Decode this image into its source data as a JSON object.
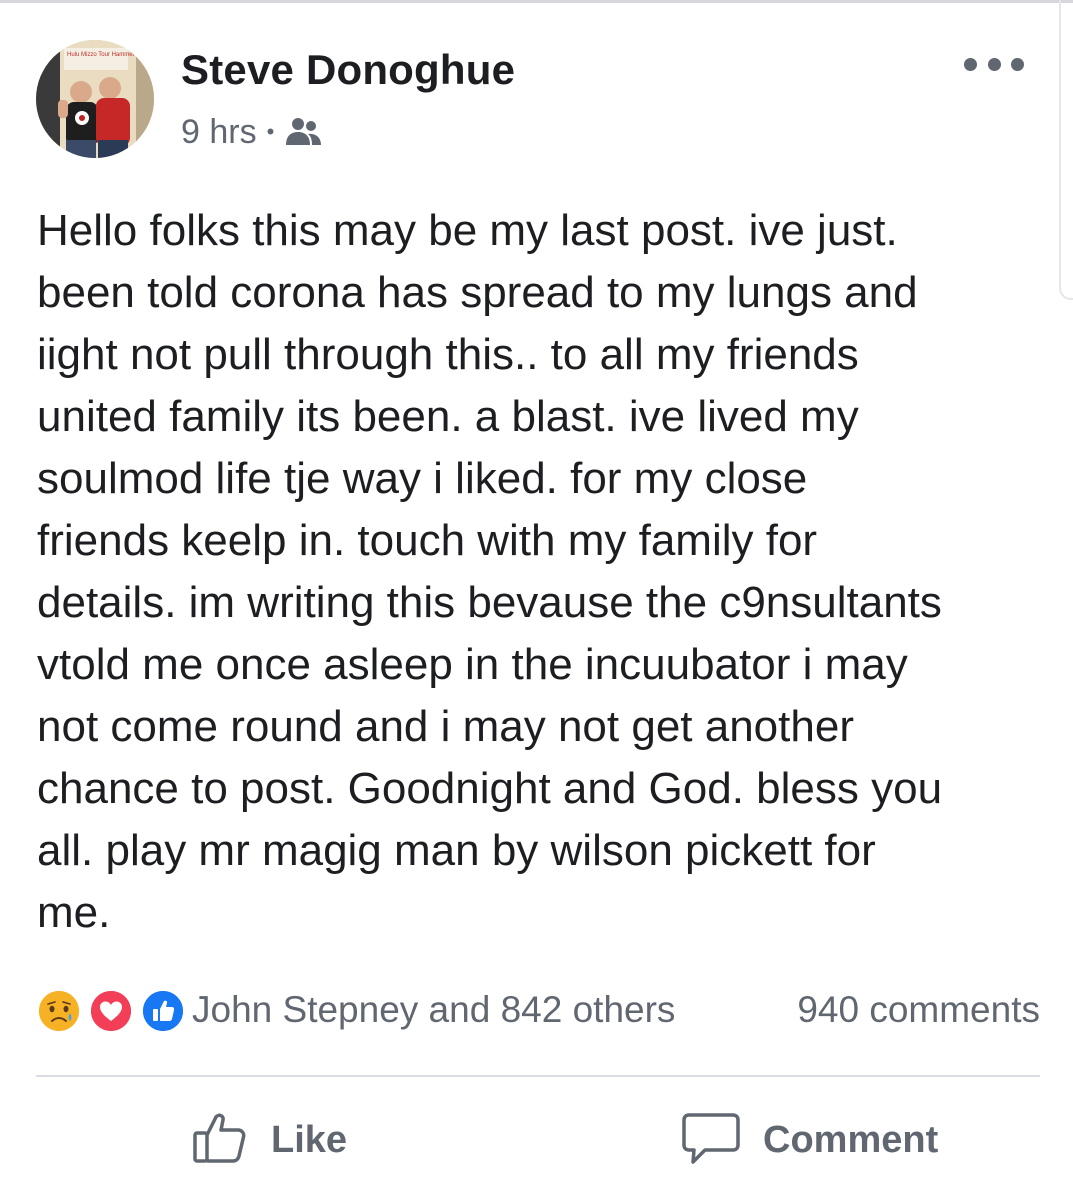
{
  "post": {
    "author": "Steve Donoghue",
    "timestamp": "9 hrs",
    "separator": "•",
    "audience_icon": "friends-icon",
    "avatar_caption": "Hulu Mizzo Tour Hammers",
    "body": "Hello folks this may be my last post. ive just.\nbeen told corona has spread to my lungs and\niight not pull through this.. to all my friends\nunited family its been. a blast. ive lived my\nsoulmod life tje way i liked. for my close\nfriends keelp in. touch with my family for\ndetails. im writing this bevause the c9nsultants\nvtold me once asleep in the incuubator i may\nnot come round and i may not get another\nchance to post. Goodnight and God. bless you\nall.  play mr magig man by wilson pickett for\nme."
  },
  "reactions": {
    "icons": [
      "sad-reaction-icon",
      "love-reaction-icon",
      "like-reaction-icon"
    ],
    "summary": "John Stepney and 842 others",
    "comments": "940 comments"
  },
  "actions": {
    "like_label": "Like",
    "comment_label": "Comment"
  },
  "colors": {
    "secondary_text": "#606770",
    "like_blue": "#1877f2",
    "love_red": "#f33e58",
    "sad_yellow": "#f7b125"
  }
}
